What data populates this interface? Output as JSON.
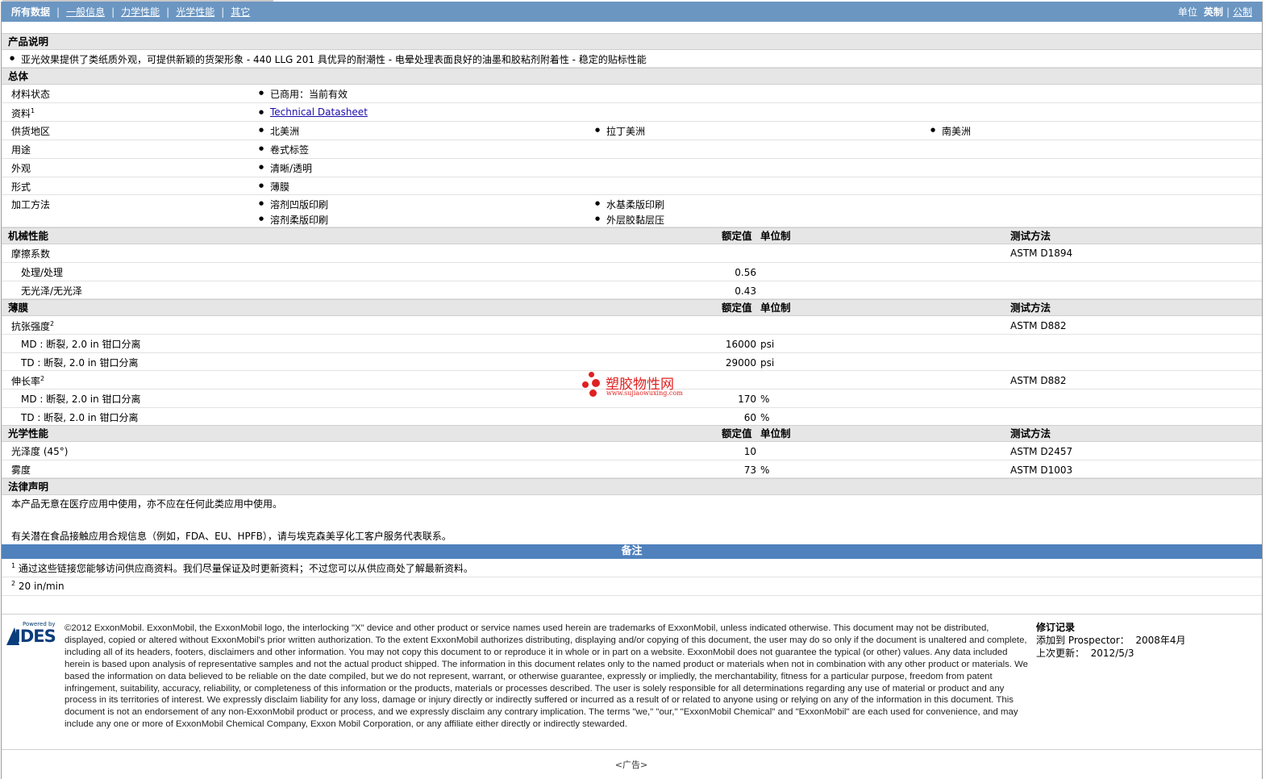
{
  "nav": {
    "tabs": [
      "所有数据",
      "一般信息",
      "力学性能",
      "光学性能",
      "其它"
    ],
    "units_label": "单位",
    "unit_current": "英制",
    "unit_other": "公制"
  },
  "product_desc": {
    "title": "产品说明",
    "text": "亚光效果提供了类纸质外观，可提供新颖的货架形象 - 440 LLG 201 具优异的耐潮性 - 电晕处理表面良好的油墨和胶粘剂附着性 - 稳定的贴标性能"
  },
  "general": {
    "title": "总体",
    "rows": [
      {
        "label": "材料状态",
        "values": [
          "已商用：当前有效"
        ]
      },
      {
        "label": "资料",
        "sup": "1",
        "link": "Technical Datasheet"
      },
      {
        "label": "供货地区",
        "values": [
          "北美洲",
          "拉丁美洲",
          "南美洲"
        ]
      },
      {
        "label": "用途",
        "values": [
          "卷式标签"
        ]
      },
      {
        "label": "外观",
        "values": [
          "清晰/透明"
        ]
      },
      {
        "label": "形式",
        "values": [
          "薄膜"
        ]
      },
      {
        "label": "加工方法",
        "values": [
          "溶剂凹版印刷",
          "水基柔版印刷",
          "溶剂柔版印刷",
          "外层胶黏层压"
        ]
      }
    ]
  },
  "columns": {
    "nominal": "额定值",
    "unit": "单位制",
    "method": "测试方法"
  },
  "mechanical": {
    "title": "机械性能",
    "friction": {
      "label": "摩擦系数",
      "method": "ASTM D1894"
    },
    "rows": [
      {
        "label": "处理/处理",
        "value": "0.56"
      },
      {
        "label": "无光泽/无光泽",
        "value": "0.43"
      }
    ]
  },
  "film": {
    "title": "薄膜",
    "tensile": {
      "label": "抗张强度",
      "sup": "2",
      "method": "ASTM D882"
    },
    "tensile_rows": [
      {
        "label": "MD : 断裂, 2.0 in 钳口分离",
        "value": "16000",
        "unit": "psi"
      },
      {
        "label": "TD : 断裂, 2.0 in 钳口分离",
        "value": "29000",
        "unit": "psi"
      }
    ],
    "elong": {
      "label": "伸长率",
      "sup": "2",
      "method": "ASTM D882"
    },
    "elong_rows": [
      {
        "label": "MD : 断裂, 2.0 in 钳口分离",
        "value": "170",
        "unit": "%"
      },
      {
        "label": "TD : 断裂, 2.0 in 钳口分离",
        "value": "60",
        "unit": "%"
      }
    ]
  },
  "optical": {
    "title": "光学性能",
    "rows": [
      {
        "label": "光泽度 (45°)",
        "value": "10",
        "unit": "",
        "method": "ASTM D2457"
      },
      {
        "label": "雾度",
        "value": "73",
        "unit": "%",
        "method": "ASTM D1003"
      }
    ]
  },
  "legal": {
    "title": "法律声明",
    "line1": "本产品无意在医疗应用中使用，亦不应在任何此类应用中使用。",
    "line2": "有关潜在食品接触应用合规信息（例如，FDA、EU、HPFB），请与埃克森美孚化工客户服务代表联系。"
  },
  "notes": {
    "title": "备注",
    "items": [
      {
        "sup": "1",
        "text": "通过这些链接您能够访问供应商资料。我们尽量保证及时更新资料；不过您可以从供应商处了解最新资料。"
      },
      {
        "sup": "2",
        "text": "20 in/min"
      }
    ]
  },
  "watermark": {
    "cn": "塑胶物性网",
    "url": "www.sujiaowuxing.com"
  },
  "footer": {
    "logo_powered": "Powered by",
    "logo_text": "IDES",
    "copyright": "©2012 ExxonMobil. ExxonMobil, the ExxonMobil logo, the interlocking \"X\" device and other product or service names used herein are trademarks of ExxonMobil, unless indicated otherwise. This document may not be distributed, displayed, copied or altered without ExxonMobil's prior written authorization. To the extent ExxonMobil authorizes distributing, displaying and/or copying of this document, the user may do so only if the document is unaltered and complete, including all of its headers, footers, disclaimers and other information. You may not copy this document to or reproduce it in whole or in part on a website. ExxonMobil does not guarantee the typical (or other) values. Any data included herein is based upon analysis of representative samples and not the actual product shipped. The information in this document relates only to the named product or materials when not in combination with any other product or materials. We based the information on data believed to be reliable on the date compiled, but we do not represent, warrant, or otherwise guarantee, expressly or impliedly, the merchantability, fitness for a particular purpose, freedom from patent infringement, suitability, accuracy, reliability, or completeness of this information or the products, materials or processes described. The user is solely responsible for all determinations regarding any use of material or product and any process in its territories of interest. We expressly disclaim liability for any loss, damage or injury directly or indirectly suffered or incurred as a result of or related to anyone using or relying on any of the information in this document. This document is not an endorsement of any non-ExxonMobil product or process, and we expressly disclaim any contrary implication. The terms \"we,\" \"our,\" \"ExxonMobil Chemical\" and \"ExxonMobil\" are each used for convenience, and may include any one or more of ExxonMobil Chemical Company, Exxon Mobil Corporation, or any affiliate either directly or indirectly stewarded.",
    "revision_title": "修订记录",
    "added_label": "添加到 Prospector：",
    "added_value": "2008年4月",
    "updated_label": "上次更新：",
    "updated_value": "2012/5/3",
    "ad": "<广告>"
  }
}
